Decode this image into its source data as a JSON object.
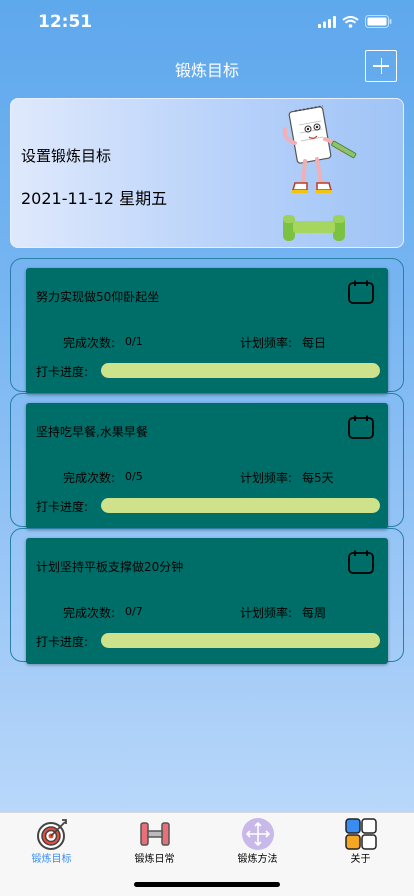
{
  "status_bar": {
    "time": "12:51"
  },
  "nav": {
    "title": "锻炼目标"
  },
  "header": {
    "title": "设置锻炼目标",
    "date": "2021-11-12 星期五"
  },
  "goals": [
    {
      "name": "努力实现做50仰卧起坐",
      "done_label": "完成次数:",
      "done_value": "0/1",
      "freq_label": "计划频率:",
      "freq_value": "每日",
      "progress_label": "打卡进度:",
      "progress": 0
    },
    {
      "name": "坚持吃早餐,水果早餐",
      "done_label": "完成次数:",
      "done_value": "0/5",
      "freq_label": "计划频率:",
      "freq_value": "每5天",
      "progress_label": "打卡进度:",
      "progress": 0
    },
    {
      "name": "计划坚持平板支撑做20分钟",
      "done_label": "完成次数:",
      "done_value": "0/7",
      "freq_label": "计划频率:",
      "freq_value": "每周",
      "progress_label": "打卡进度:",
      "progress": 0
    }
  ],
  "tabs": [
    {
      "label": "锻炼目标",
      "icon": "target-icon",
      "active": true
    },
    {
      "label": "锻炼日常",
      "icon": "dumbbell-icon",
      "active": false
    },
    {
      "label": "锻炼方法",
      "icon": "move-arrows-icon",
      "active": false
    },
    {
      "label": "关于",
      "icon": "grid-icon",
      "active": false
    }
  ],
  "colors": {
    "card": "#006e68",
    "progress_track": "#cde28a",
    "active_tab": "#3a8df0"
  }
}
